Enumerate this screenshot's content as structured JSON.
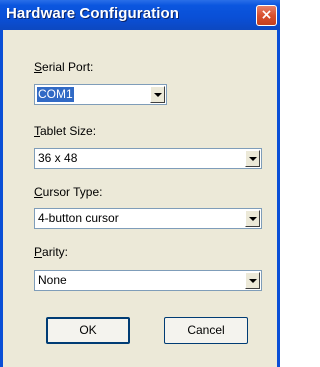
{
  "window": {
    "title": "Hardware Configuration",
    "close_glyph": "×"
  },
  "fields": {
    "serial_port": {
      "accesskey": "S",
      "label_rest": "erial Port:",
      "value": "COM1"
    },
    "tablet_size": {
      "accesskey": "T",
      "label_rest": "ablet Size:",
      "value": "36 x 48"
    },
    "cursor_type": {
      "accesskey": "C",
      "label_rest": "ursor Type:",
      "value": "4-button cursor"
    },
    "parity": {
      "accesskey": "P",
      "label_rest": "arity:",
      "value": "None"
    }
  },
  "buttons": {
    "ok_label": "OK",
    "cancel_label": "Cancel"
  },
  "colors": {
    "titlebar": "#0a4fd6",
    "selection": "#316ac5",
    "dialog_bg": "#ece9d8"
  }
}
